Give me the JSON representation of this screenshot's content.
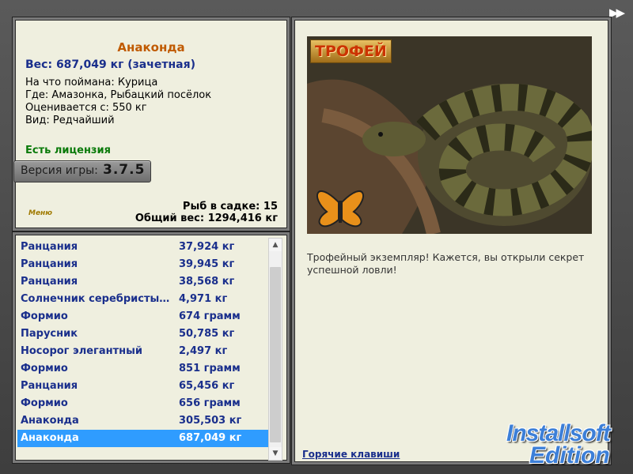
{
  "top_nav": {
    "arrows_label": "▶▶"
  },
  "info": {
    "fish_name": "Анаконда",
    "weight_line": "Вес: 687,049 кг (зачетная)",
    "caught_on": "На что поймана: Курица",
    "where": "Где: Амазонка, Рыбацкий посёлок",
    "valued_from": "Оценивается с: 550 кг",
    "kind": "Вид: Редчайший",
    "license": "Есть лицензия",
    "version_label": "Версия игры:",
    "version_number": "3.7.5",
    "menu": "Меню",
    "net_count": "Рыб в садке: 15",
    "total_weight": "Общий вес: 1294,416 кг"
  },
  "catches": [
    {
      "name": "Ранцания",
      "weight": "37,924 кг"
    },
    {
      "name": "Ранцания",
      "weight": "39,945 кг"
    },
    {
      "name": "Ранцания",
      "weight": "38,568 кг"
    },
    {
      "name": "Солнечник серебристы…",
      "weight": "4,971 кг"
    },
    {
      "name": "Формио",
      "weight": "674 грамм"
    },
    {
      "name": "Парусник",
      "weight": "50,785 кг"
    },
    {
      "name": "Носорог элегантный",
      "weight": "2,497 кг"
    },
    {
      "name": "Формио",
      "weight": "851 грамм"
    },
    {
      "name": "Ранцания",
      "weight": "65,456 кг"
    },
    {
      "name": "Формио",
      "weight": "656 грамм"
    },
    {
      "name": "Анаконда",
      "weight": "305,503 кг"
    },
    {
      "name": "Анаконда",
      "weight": "687,049 кг",
      "selected": true
    }
  ],
  "trophy": {
    "badge": "ТРОФЕЙ",
    "description": "Трофейный экземпляр! Кажется, вы открыли секрет успешной ловли!",
    "hotkeys": "Горячие клавиши"
  },
  "brand": {
    "line1": "Installsoft",
    "line2": "Edition"
  },
  "colors": {
    "accent_blue": "#1a2f8c",
    "title_orange": "#c05a00",
    "license_green": "#0a7a0a",
    "selection": "#2f9cff"
  }
}
